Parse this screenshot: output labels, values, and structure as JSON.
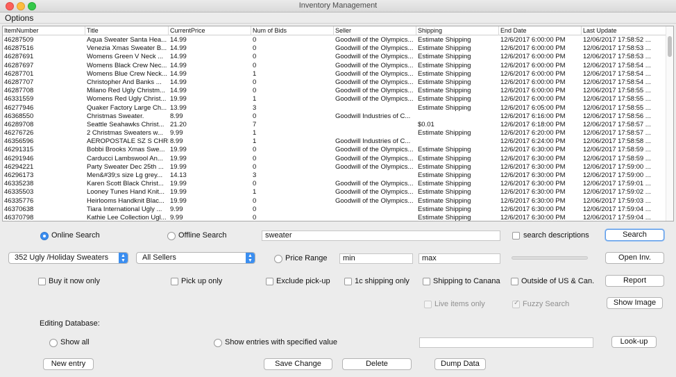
{
  "window": {
    "title": "Inventory Management"
  },
  "menu": {
    "options": "Options"
  },
  "table": {
    "headers": [
      "ItemNumber",
      "Title",
      "CurrentPrice",
      "Num of Bids",
      "Seller",
      "Shipping",
      "End Date",
      "Last Update"
    ],
    "rows": [
      [
        "46287509",
        "Aqua Sweater Santa Hea...",
        "14.99",
        "0",
        "Goodwill of the Olympics...",
        "Estimate Shipping",
        "12/6/2017 6:00:00 PM",
        "12/06/2017 17:58:52 ..."
      ],
      [
        "46287516",
        "Venezia Xmas Sweater B...",
        "14.99",
        "0",
        "Goodwill of the Olympics...",
        "Estimate Shipping",
        "12/6/2017 6:00:00 PM",
        "12/06/2017 17:58:53 ..."
      ],
      [
        "46287691",
        "Womens Green V Neck ...",
        "14.99",
        "0",
        "Goodwill of the Olympics...",
        "Estimate Shipping",
        "12/6/2017 6:00:00 PM",
        "12/06/2017 17:58:53 ..."
      ],
      [
        "46287697",
        "Womens Black Crew Nec...",
        "14.99",
        "0",
        "Goodwill of the Olympics...",
        "Estimate Shipping",
        "12/6/2017 6:00:00 PM",
        "12/06/2017 17:58:54 ..."
      ],
      [
        "46287701",
        "Womens Blue Crew Neck...",
        "14.99",
        "1",
        "Goodwill of the Olympics...",
        "Estimate Shipping",
        "12/6/2017 6:00:00 PM",
        "12/06/2017 17:58:54 ..."
      ],
      [
        "46287707",
        "Christopher And Banks ...",
        "14.99",
        "0",
        "Goodwill of the Olympics...",
        "Estimate Shipping",
        "12/6/2017 6:00:00 PM",
        "12/06/2017 17:58:54 ..."
      ],
      [
        "46287708",
        "Milano Red Ugly Christm...",
        "14.99",
        "0",
        "Goodwill of the Olympics...",
        "Estimate Shipping",
        "12/6/2017 6:00:00 PM",
        "12/06/2017 17:58:55 ..."
      ],
      [
        "46331559",
        "Womens Red Ugly Christ...",
        "19.99",
        "1",
        "Goodwill of the Olympics...",
        "Estimate Shipping",
        "12/6/2017 6:00:00 PM",
        "12/06/2017 17:58:55 ..."
      ],
      [
        "46277946",
        "Quaker Factory Large Ch...",
        "13.99",
        "3",
        "",
        "Estimate Shipping",
        "12/6/2017 6:05:00 PM",
        "12/06/2017 17:58:55 ..."
      ],
      [
        "46368550",
        "Christmas Sweater.",
        "8.99",
        "0",
        "Goodwill Industries of C...",
        "",
        "12/6/2017 6:16:00 PM",
        "12/06/2017 17:58:56 ..."
      ],
      [
        "46289708",
        "Seattle Seahawks Christ...",
        "21.20",
        "7",
        "",
        "$0.01",
        "12/6/2017 6:18:00 PM",
        "12/06/2017 17:58:57 ..."
      ],
      [
        "46276726",
        "2 Christmas Sweaters w...",
        "9.99",
        "1",
        "",
        "Estimate Shipping",
        "12/6/2017 6:20:00 PM",
        "12/06/2017 17:58:57 ..."
      ],
      [
        "46356596",
        "AEROPOSTALE SZ S CHRI...",
        "8.99",
        "1",
        "Goodwill Industries of C...",
        "",
        "12/6/2017 6:24:00 PM",
        "12/06/2017 17:58:58 ..."
      ],
      [
        "46291315",
        "Bobbi Brooks Xmas Swe...",
        "19.99",
        "0",
        "Goodwill of the Olympics...",
        "Estimate Shipping",
        "12/6/2017 6:30:00 PM",
        "12/06/2017 17:58:59 ..."
      ],
      [
        "46291946",
        "Carducci Lambswool An...",
        "19.99",
        "0",
        "Goodwill of the Olympics...",
        "Estimate Shipping",
        "12/6/2017 6:30:00 PM",
        "12/06/2017 17:58:59 ..."
      ],
      [
        "46294221",
        "Party Sweater Dec 25th ...",
        "19.99",
        "0",
        "Goodwill of the Olympics...",
        "Estimate Shipping",
        "12/6/2017 6:30:00 PM",
        "12/06/2017 17:59:00 ..."
      ],
      [
        "46296173",
        "Men&#39;s size Lg grey...",
        "14.13",
        "3",
        "",
        "Estimate Shipping",
        "12/6/2017 6:30:00 PM",
        "12/06/2017 17:59:00 ..."
      ],
      [
        "46335238",
        "Karen Scott Black Christ...",
        "19.99",
        "0",
        "Goodwill of the Olympics...",
        "Estimate Shipping",
        "12/6/2017 6:30:00 PM",
        "12/06/2017 17:59:01 ..."
      ],
      [
        "46335503",
        "Looney Tunes Hand Knit...",
        "19.99",
        "1",
        "Goodwill of the Olympics...",
        "Estimate Shipping",
        "12/6/2017 6:30:00 PM",
        "12/06/2017 17:59:02 ..."
      ],
      [
        "46335776",
        "Heirlooms Handknit Blac...",
        "19.99",
        "0",
        "Goodwill of the Olympics...",
        "Estimate Shipping",
        "12/6/2017 6:30:00 PM",
        "12/06/2017 17:59:03 ..."
      ],
      [
        "46370638",
        "Tiara International Ugly ...",
        "9.99",
        "0",
        "",
        "Estimate Shipping",
        "12/6/2017 6:30:00 PM",
        "12/06/2017 17:59:04 ..."
      ],
      [
        "46370798",
        "Kathie Lee Collection Ugl...",
        "9.99",
        "0",
        "",
        "Estimate Shipping",
        "12/6/2017 6:30:00 PM",
        "12/06/2017 17:59:04 ..."
      ]
    ]
  },
  "controls": {
    "online_search": "Online Search",
    "offline_search": "Offline Search",
    "search_value": "sweater",
    "search_descriptions": "search descriptions",
    "search_button": "Search",
    "category_select": "352 Ugly /Holiday Sweaters",
    "seller_select": "All Sellers",
    "price_range": "Price Range",
    "min_value": "min",
    "max_value": "max",
    "open_inv_button": "Open Inv.",
    "buy_it_now": "Buy it now only",
    "pick_up_only": "Pick up only",
    "exclude_pickup": "Exclude pick-up",
    "one_cent_shipping": "1c shipping only",
    "shipping_canada": "Shipping to Canana",
    "outside_us": "Outside of US & Can.",
    "report_button": "Report",
    "live_items": "Live items only",
    "fuzzy_search": "Fuzzy Search",
    "show_image_button": "Show Image",
    "editing_database": "Editing Database:",
    "show_all": "Show all",
    "show_specified": "Show entries with specified value",
    "lookup_button": "Look-up",
    "new_entry_button": "New entry",
    "save_change_button": "Save Change",
    "delete_button": "Delete",
    "dump_data_button": "Dump Data"
  },
  "colors": {
    "accent": "#3b8ef0",
    "window_bg": "#ececec"
  }
}
